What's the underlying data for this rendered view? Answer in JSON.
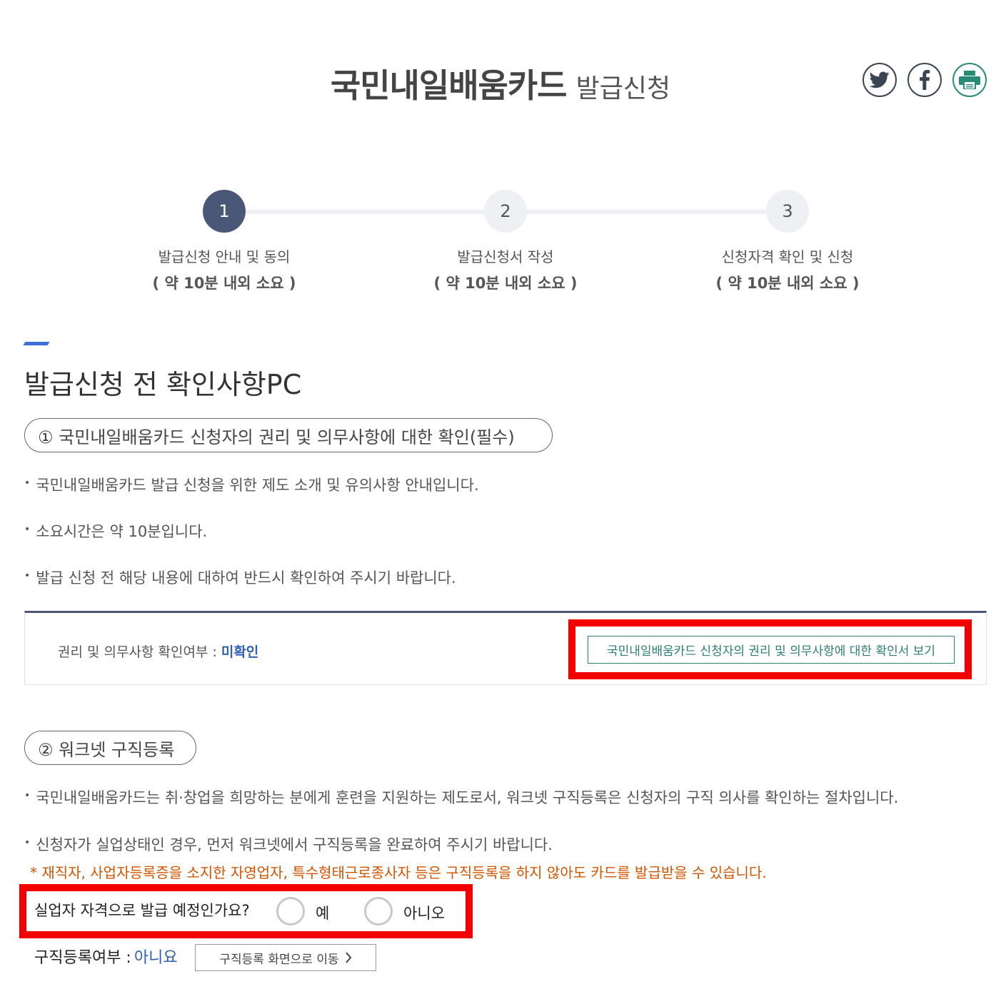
{
  "header": {
    "title_main": "국민내일배움카드",
    "title_sub": "발급신청",
    "share": {
      "twitter_icon": "twitter-icon",
      "facebook_icon": "facebook-icon",
      "print_icon": "printer-icon"
    }
  },
  "steps": [
    {
      "number": "1",
      "title": "발급신청 안내 및 동의",
      "time": "( 약 10분 내외 소요 )",
      "active": true
    },
    {
      "number": "2",
      "title": "발급신청서 작성",
      "time": "( 약 10분 내외 소요 )",
      "active": false
    },
    {
      "number": "3",
      "title": "신청자격 확인 및 신청",
      "time": "( 약 10분 내외 소요 )",
      "active": false
    }
  ],
  "section": {
    "title": "발급신청 전 확인사항PC"
  },
  "part1": {
    "heading": "① 국민내일배움카드 신청자의 권리 및 의무사항에 대한 확인(필수)",
    "bullets": [
      "국민내일배움카드 발급 신청을 위한 제도 소개 및 유의사항 안내입니다.",
      "소요시간은 약 10분입니다.",
      "발급 신청 전 해당 내용에 대하여 반드시 확인하여 주시기 바랍니다."
    ],
    "confirm_label": "권리 및 의무사항 확인여부 :",
    "confirm_status": "미확인",
    "view_button": "국민내일배움카드 신청자의 권리 및 의무사항에 대한 확인서 보기"
  },
  "part2": {
    "heading": "② 워크넷 구직등록",
    "bullets": [
      "국민내일배움카드는 취·창업을 희망하는 분에게 훈련을 지원하는 제도로서, 워크넷 구직등록은 신청자의 구직 의사를 확인하는 절차입니다.",
      "신청자가 실업상태인 경우, 먼저 워크넷에서 구직등록을 완료하여 주시기 바랍니다."
    ],
    "note": "* 재직자, 사업자등록증을 소지한 자영업자, 특수형태근로종사자 등은 구직등록을 하지 않아도 카드를 발급받을 수 있습니다.",
    "question": "실업자 자격으로 발급 예정인가요?",
    "option_yes": "예",
    "option_no": "아니오",
    "reg_label": "구직등록여부 :",
    "reg_value": "아니요",
    "reg_button": "구직등록 화면으로 이동"
  },
  "colors": {
    "accent_blue": "#3d6fd6",
    "step_active": "#4b5777",
    "highlight_red": "#f50000",
    "button_green": "#2d7f73",
    "note_orange": "#d35400",
    "status_blue": "#2f5fb0"
  }
}
